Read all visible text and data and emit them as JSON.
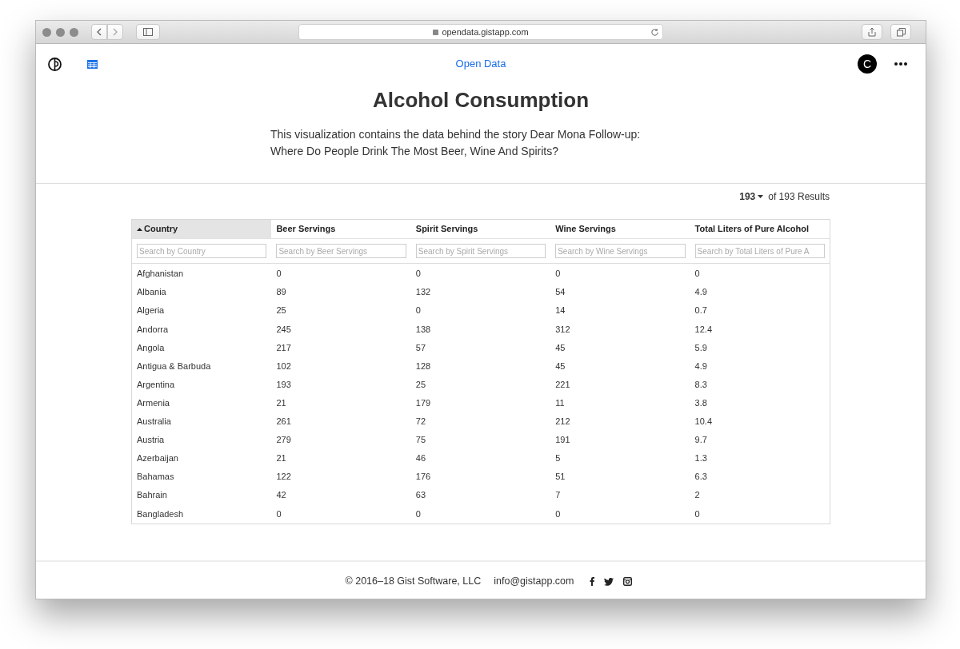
{
  "browser": {
    "url": "opendata.gistapp.com"
  },
  "nav": {
    "title": "Open Data",
    "avatar": "C"
  },
  "page": {
    "title": "Alcohol Consumption",
    "description": "This visualization contains the data behind the story Dear Mona Follow-up: Where Do People Drink The Most Beer, Wine And Spirits?"
  },
  "results": {
    "count": "193",
    "total": "of 193 Results"
  },
  "table": {
    "columns": [
      {
        "label": "Country",
        "sorted": true,
        "placeholder": "Search by Country"
      },
      {
        "label": "Beer Servings",
        "sorted": false,
        "placeholder": "Search by Beer Servings"
      },
      {
        "label": "Spirit Servings",
        "sorted": false,
        "placeholder": "Search by Spirit Servings"
      },
      {
        "label": "Wine Servings",
        "sorted": false,
        "placeholder": "Search by Wine Servings"
      },
      {
        "label": "Total Liters of Pure Alcohol",
        "sorted": false,
        "placeholder": "Search by Total Liters of Pure A"
      }
    ],
    "rows": [
      [
        "Afghanistan",
        "0",
        "0",
        "0",
        "0"
      ],
      [
        "Albania",
        "89",
        "132",
        "54",
        "4.9"
      ],
      [
        "Algeria",
        "25",
        "0",
        "14",
        "0.7"
      ],
      [
        "Andorra",
        "245",
        "138",
        "312",
        "12.4"
      ],
      [
        "Angola",
        "217",
        "57",
        "45",
        "5.9"
      ],
      [
        "Antigua & Barbuda",
        "102",
        "128",
        "45",
        "4.9"
      ],
      [
        "Argentina",
        "193",
        "25",
        "221",
        "8.3"
      ],
      [
        "Armenia",
        "21",
        "179",
        "11",
        "3.8"
      ],
      [
        "Australia",
        "261",
        "72",
        "212",
        "10.4"
      ],
      [
        "Austria",
        "279",
        "75",
        "191",
        "9.7"
      ],
      [
        "Azerbaijan",
        "21",
        "46",
        "5",
        "1.3"
      ],
      [
        "Bahamas",
        "122",
        "176",
        "51",
        "6.3"
      ],
      [
        "Bahrain",
        "42",
        "63",
        "7",
        "2"
      ],
      [
        "Bangladesh",
        "0",
        "0",
        "0",
        "0"
      ]
    ]
  },
  "footer": {
    "copyright": "© 2016–18 Gist Software, LLC",
    "email": "info@gistapp.com"
  }
}
